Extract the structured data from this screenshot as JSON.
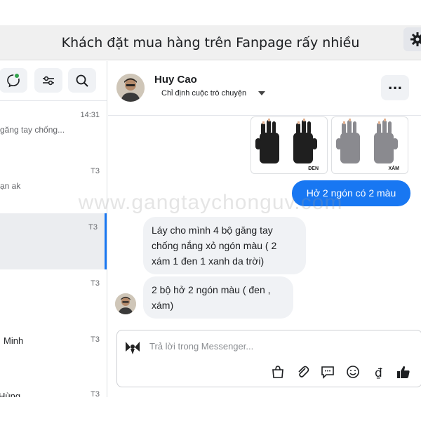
{
  "title": "Khách đặt mua hàng trên Fanpage rấy nhiều",
  "watermark": "www.gangtaychonguv.com",
  "sidebar": {
    "conversations": [
      {
        "time": "14:31",
        "snippet": "găng tay chống..."
      },
      {
        "time": "T3",
        "snippet": "ạn ak"
      },
      {
        "time": "T3",
        "snippet": ""
      },
      {
        "time": "T3",
        "snippet": ""
      },
      {
        "time": "T3",
        "snippet": "Minh"
      },
      {
        "time": "T3",
        "snippet": "Hùng"
      }
    ]
  },
  "contact": {
    "name": "Huy Cao",
    "assign_label": "Chỉ định cuộc trò chuyện"
  },
  "products": [
    {
      "label": "ĐEN",
      "color": "#1f1f1f"
    },
    {
      "label": "XÁM",
      "color": "#8a8a8f"
    }
  ],
  "messages": {
    "outgoing": "Hở 2 ngón có 2 màu",
    "incoming1": "Láy cho mình 4 bộ găng tay chống nắng xỏ ngón màu ( 2 xám 1 đen 1 xanh da trời)",
    "incoming2": "2 bộ hở 2 ngón màu ( đen , xám)"
  },
  "composer": {
    "placeholder": "Trả lời trong Messenger..."
  },
  "colors": {
    "accent": "#1877f2",
    "online": "#31a24c"
  }
}
